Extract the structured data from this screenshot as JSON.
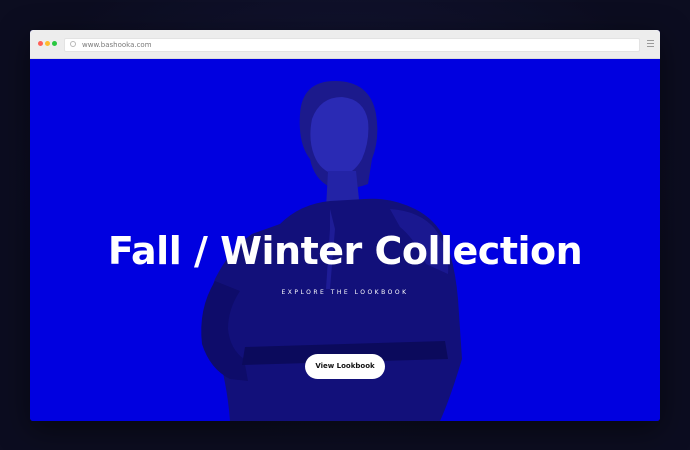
{
  "browser": {
    "url": "www.bashooka.com"
  },
  "hero": {
    "headline": "Fall / Winter Collection",
    "subheading": "EXPLORE THE LOOKBOOK",
    "cta_label": "View Lookbook"
  },
  "colors": {
    "hero_background": "#0000e0",
    "headline_text": "#ffffff",
    "cta_background": "#ffffff",
    "cta_text": "#111111"
  }
}
